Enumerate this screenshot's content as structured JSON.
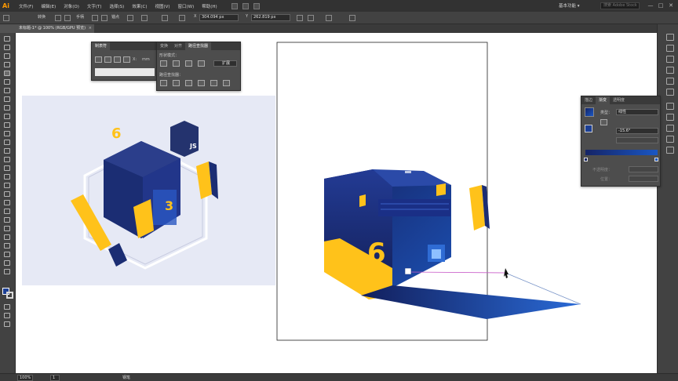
{
  "app": {
    "logo": "Ai",
    "menus": [
      "文件(F)",
      "编辑(E)",
      "对象(O)",
      "文字(T)",
      "选择(S)",
      "效果(C)",
      "视图(V)",
      "窗口(W)",
      "帮助(H)"
    ],
    "workspace": "基本功能 ▾",
    "search_placeholder": "搜索 Adobe Stock",
    "win_minimize": "—",
    "win_maximize": "□",
    "win_close": "✕"
  },
  "control": {
    "convert_label": "转换",
    "handle_label": "手柄",
    "anchor_label": "锚点",
    "x_label": "X",
    "x_value": "304.094 px",
    "y_label": "Y",
    "y_value": "262.819 px"
  },
  "document": {
    "tab_title": "未标题-1* @ 100% (RGB/GPU 预览)",
    "tab_close": "×"
  },
  "panels": {
    "align_panel": {
      "tab": "制表符",
      "x_label": "X:",
      "unit": "mm"
    },
    "pathfinder": {
      "tabs": [
        "变换",
        "对齐",
        "路径查找器"
      ],
      "shape_modes": "形状模式：",
      "pathfinders": "路径查找器：",
      "expand": "扩展"
    },
    "gradient": {
      "tabs": [
        "描边",
        "渐变",
        "透明度"
      ],
      "type_label": "类型：",
      "type_value": "线性",
      "angle_value": "-15.6°",
      "opacity_label": "不透明度：",
      "location_label": "位置：",
      "colors": {
        "start": "#1c2a6e",
        "end": "#1a57c4"
      }
    }
  },
  "status": {
    "zoom": "100%",
    "page": "1",
    "tool_name": "钢笔"
  },
  "colors": {
    "navy": "#17276a",
    "blue": "#1c4fb0",
    "yellow": "#ffc21a",
    "canvas": "#ffffff",
    "artboard_bg": "#e6e9f5",
    "selection": "#c85ac8"
  },
  "artwork": {
    "left_digit_top": "6",
    "left_js": "JS",
    "left_digit_front": "3",
    "right_digit": "6"
  }
}
